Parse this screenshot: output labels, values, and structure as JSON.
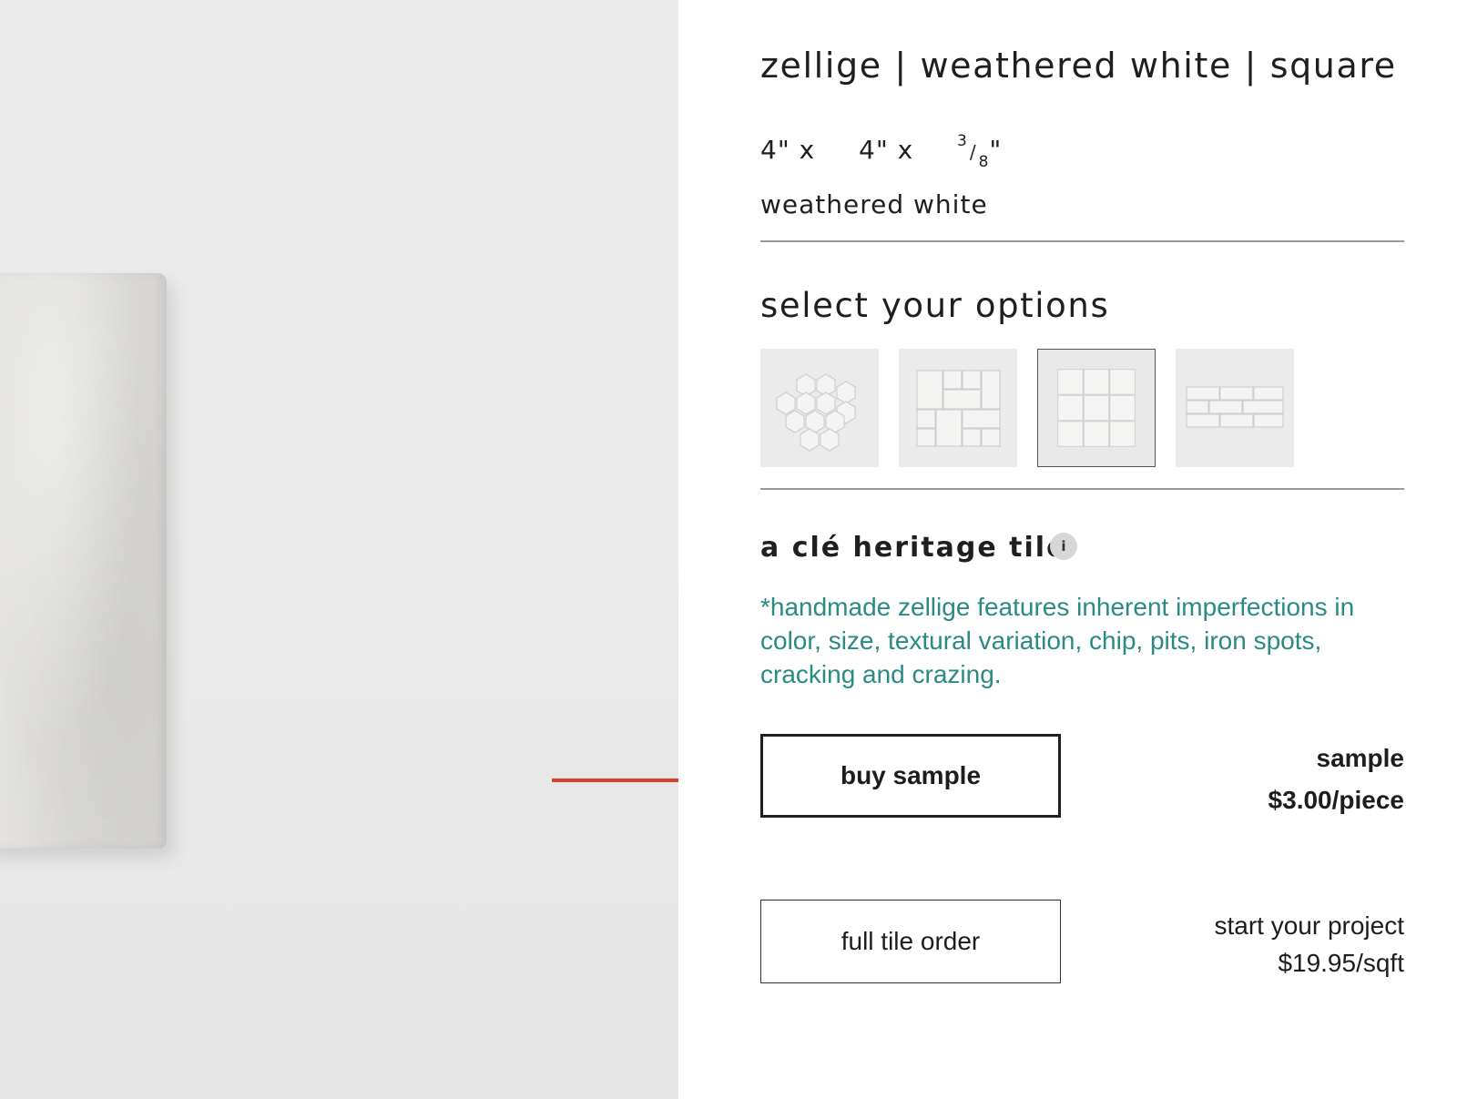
{
  "product": {
    "title": "zellige | weathered white | square",
    "dimensions": {
      "width": "4\"",
      "height": "4\"",
      "x_separator": "x",
      "thickness_numerator": "3",
      "thickness_denominator": "8",
      "thickness_unit": "\""
    },
    "color_name": "weathered white"
  },
  "options": {
    "heading": "select your options",
    "items": [
      {
        "icon": "hexagon-tile-option-icon",
        "selected": false
      },
      {
        "icon": "mixed-square-tile-option-icon",
        "selected": false
      },
      {
        "icon": "square-tile-option-icon",
        "selected": true
      },
      {
        "icon": "rectangle-tile-option-icon",
        "selected": false
      }
    ]
  },
  "heritage": {
    "label": "a clé heritage tile",
    "info_glyph": "i",
    "disclaimer": "*handmade zellige features inherent imperfections in color, size, textural variation, chip, pits, iron spots, cracking and crazing.",
    "disclaimer_color": "#2a8a84"
  },
  "actions": {
    "buy_sample_label": "buy sample",
    "sample_caption": "sample",
    "sample_price": "$3.00/piece",
    "full_order_label": "full tile order",
    "full_caption": "start your project",
    "full_price": "$19.95/sqft"
  },
  "annotation": {
    "arrow_color": "#d9402b"
  }
}
